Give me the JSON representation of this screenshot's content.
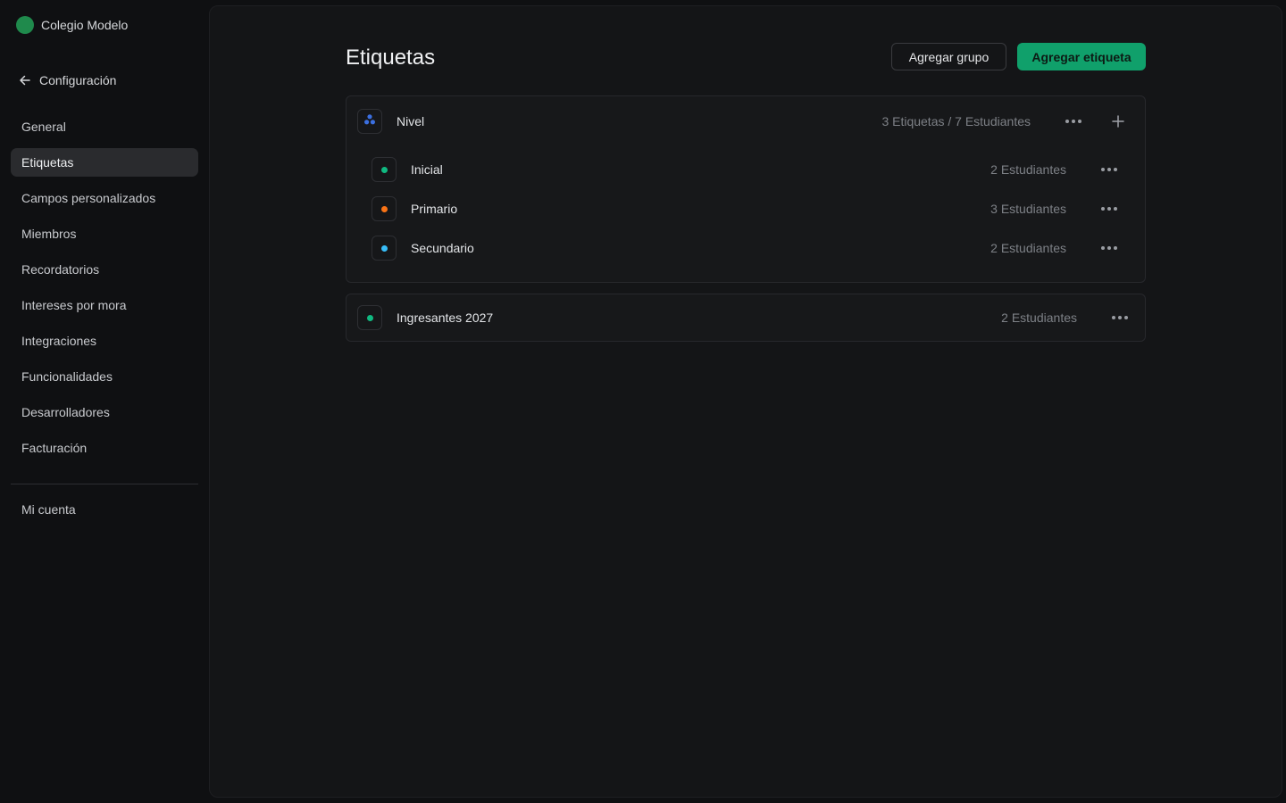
{
  "org": {
    "name": "Colegio Modelo",
    "avatar_color": "#1f8a4c"
  },
  "back": {
    "label": "Configuración"
  },
  "sidebar": {
    "items": [
      {
        "label": "General"
      },
      {
        "label": "Etiquetas",
        "active": true
      },
      {
        "label": "Campos personalizados"
      },
      {
        "label": "Miembros"
      },
      {
        "label": "Recordatorios"
      },
      {
        "label": "Intereses por mora"
      },
      {
        "label": "Integraciones"
      },
      {
        "label": "Funcionalidades"
      },
      {
        "label": "Desarrolladores"
      },
      {
        "label": "Facturación"
      }
    ],
    "account": "Mi cuenta"
  },
  "main": {
    "title": "Etiquetas",
    "buttons": {
      "add_group": "Agregar grupo",
      "add_tag": "Agregar etiqueta"
    },
    "groups": [
      {
        "name": "Nivel",
        "icon": "group-icon",
        "icon_color": "#3b6fe0",
        "summary": "3 Etiquetas / 7 Estudiantes",
        "tags": [
          {
            "name": "Inicial",
            "color": "#10b981",
            "count": "2 Estudiantes"
          },
          {
            "name": "Primario",
            "color": "#f97316",
            "count": "3 Estudiantes"
          },
          {
            "name": "Secundario",
            "color": "#38bdf8",
            "count": "2 Estudiantes"
          }
        ]
      }
    ],
    "single_tags": [
      {
        "name": "Ingresantes 2027",
        "color": "#10b981",
        "count": "2 Estudiantes"
      }
    ]
  },
  "colors": {
    "accent": "#10a06b",
    "background": "#0f1012",
    "panel": "#141517"
  }
}
